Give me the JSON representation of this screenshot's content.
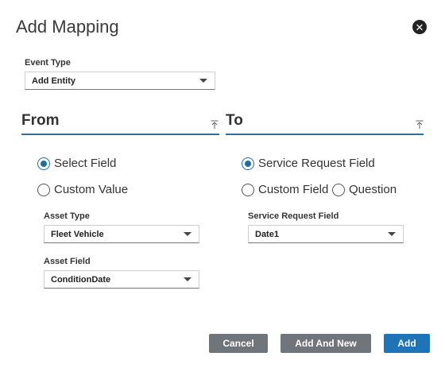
{
  "dialog": {
    "title": "Add Mapping"
  },
  "event_type": {
    "label": "Event Type",
    "value": "Add Entity"
  },
  "from": {
    "title": "From",
    "radios": {
      "select_field": "Select Field",
      "custom_value": "Custom Value"
    },
    "asset_type": {
      "label": "Asset Type",
      "value": "Fleet Vehicle"
    },
    "asset_field": {
      "label": "Asset Field",
      "value": "ConditionDate"
    }
  },
  "to": {
    "title": "To",
    "radios": {
      "service_request_field": "Service Request Field",
      "custom_field": "Custom Field",
      "question": "Question"
    },
    "service_request_field": {
      "label": "Service Request Field",
      "value": "Date1"
    }
  },
  "buttons": {
    "cancel": "Cancel",
    "add_and_new": "Add And New",
    "add": "Add"
  },
  "icons": {
    "close": "close-icon",
    "collapse": "collapse-up-icon",
    "dropdown": "chevron-down-icon"
  },
  "colors": {
    "accent": "#1f74b8",
    "secondary_button": "#6f757a",
    "section_line": "#2f6f9f"
  }
}
